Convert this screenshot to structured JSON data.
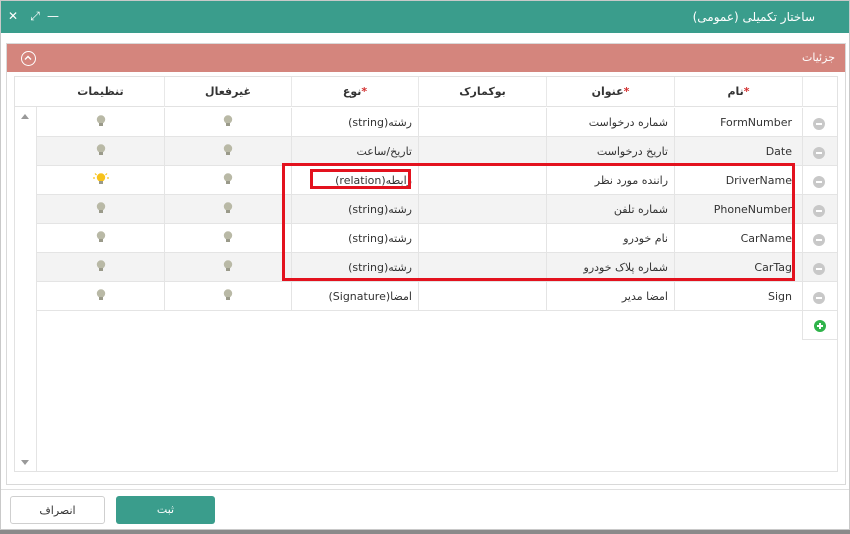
{
  "window": {
    "title": "ساختار تکمیلی (عمومی)",
    "controls": {
      "close": "✕",
      "maximize": "⤢",
      "minimize": "—"
    }
  },
  "section": {
    "label": "جزئیات"
  },
  "columns": {
    "name": "نام",
    "title": "عنوان",
    "bookmark": "بوکمارک",
    "type": "نوع",
    "inactive": "غیرفعال",
    "settings": "تنظیمات",
    "required_mark": "*"
  },
  "rows": [
    {
      "name": "FormNumber",
      "title": "شماره درخواست",
      "bookmark": "",
      "type": "رشته(string)",
      "settings_active": false
    },
    {
      "name": "Date",
      "title": "تاریخ درخواست",
      "bookmark": "",
      "type": "تاریخ/ساعت",
      "settings_active": false
    },
    {
      "name": "DriverName",
      "title": "راننده مورد نظر",
      "bookmark": "",
      "type": "رابطه(relation)",
      "settings_active": true
    },
    {
      "name": "PhoneNumber",
      "title": "شماره تلفن",
      "bookmark": "",
      "type": "رشته(string)",
      "settings_active": false
    },
    {
      "name": "CarName",
      "title": "نام خودرو",
      "bookmark": "",
      "type": "رشته(string)",
      "settings_active": false
    },
    {
      "name": "CarTag",
      "title": "شماره پلاک خودرو",
      "bookmark": "",
      "type": "رشته(string)",
      "settings_active": false
    },
    {
      "name": "Sign",
      "title": "امضا مدیر",
      "bookmark": "",
      "type": "امضا(Signature)",
      "settings_active": false
    }
  ],
  "footer": {
    "submit_label": "ثبت",
    "cancel_label": "انصراف"
  },
  "colors": {
    "accent": "#3a9d8c",
    "section": "#d4857d",
    "highlight": "#e3121e",
    "bulb_on": "#f7c21b",
    "bulb_off": "#b9b9a6"
  },
  "icons": {
    "row_remove": "minus-circle-icon",
    "row_add": "plus-circle-icon",
    "settings": "lightbulb-icon",
    "inactive": "lightbulb-icon"
  }
}
